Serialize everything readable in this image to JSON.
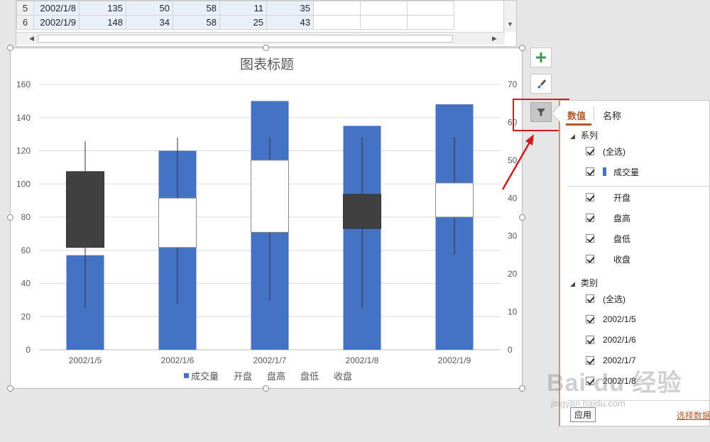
{
  "sheet": {
    "rows": [
      {
        "num": "5",
        "date": "2002/1/8",
        "values": [
          "135",
          "50",
          "58",
          "11",
          "35"
        ]
      },
      {
        "num": "6",
        "date": "2002/1/9",
        "values": [
          "148",
          "34",
          "58",
          "25",
          "43"
        ]
      }
    ]
  },
  "chart_data": {
    "type": "bar",
    "title": "图表标题",
    "categories": [
      "2002/1/5",
      "2002/1/6",
      "2002/1/7",
      "2002/1/8",
      "2002/1/9"
    ],
    "series": [
      {
        "name": "成交量",
        "axis": "primary",
        "type": "bar",
        "values": [
          57,
          120,
          150,
          135,
          148
        ],
        "color": "#4472c4"
      },
      {
        "name": "开盘",
        "axis": "secondary",
        "values": [
          47,
          27,
          31,
          32,
          35
        ]
      },
      {
        "name": "盘高",
        "axis": "secondary",
        "values": [
          55,
          56,
          56,
          56,
          56
        ]
      },
      {
        "name": "盘低",
        "axis": "secondary",
        "values": [
          11,
          12,
          13,
          11,
          25
        ]
      },
      {
        "name": "收盘",
        "axis": "secondary",
        "values": [
          27,
          40,
          50,
          41,
          44
        ]
      }
    ],
    "candles": [
      {
        "category": "2002/1/5",
        "open": 47,
        "high": 55,
        "low": 11,
        "close": 27,
        "style": "down"
      },
      {
        "category": "2002/1/6",
        "open": 27,
        "high": 56,
        "low": 12,
        "close": 40,
        "style": "up"
      },
      {
        "category": "2002/1/7",
        "open": 31,
        "high": 56,
        "low": 13,
        "close": 50,
        "style": "up"
      },
      {
        "category": "2002/1/8",
        "open": 32,
        "high": 56,
        "low": 11,
        "close": 41,
        "style": "down"
      },
      {
        "category": "2002/1/9",
        "open": 35,
        "high": 56,
        "low": 25,
        "close": 44,
        "style": "up"
      }
    ],
    "y_primary": {
      "min": 0,
      "max": 160,
      "ticks": [
        0,
        20,
        40,
        60,
        80,
        100,
        120,
        140,
        160
      ]
    },
    "y_secondary": {
      "min": 0,
      "max": 70,
      "ticks": [
        0,
        10,
        20,
        30,
        40,
        50,
        60,
        70
      ]
    },
    "grid": true,
    "legend": {
      "placement": "bottom",
      "items": [
        "成交量",
        "开盘",
        "盘高",
        "盘低",
        "收盘"
      ]
    },
    "colors": {
      "bar": "#4472c4",
      "down_body": "#404040",
      "up_body": "#ffffff",
      "grid": "#d9d9d9"
    }
  },
  "filter_pane": {
    "tabs": [
      "数值",
      "名称"
    ],
    "series_header": "系列",
    "category_header": "类别",
    "series_items": [
      "(全选)",
      "成交量",
      "开盘",
      "盘高",
      "盘低",
      "收盘"
    ],
    "category_items": [
      "(全选)",
      "2002/1/5",
      "2002/1/6",
      "2002/1/7",
      "2002/1/8"
    ],
    "apply_label": "应用",
    "select_data_label": "选择数据"
  },
  "side_buttons": {
    "add_icon": "plus-icon",
    "style_icon": "brush-icon",
    "filter_icon": "funnel-icon"
  },
  "watermark": {
    "text": "Bai du 经验",
    "url_text": "jingyan.baidu.com"
  }
}
